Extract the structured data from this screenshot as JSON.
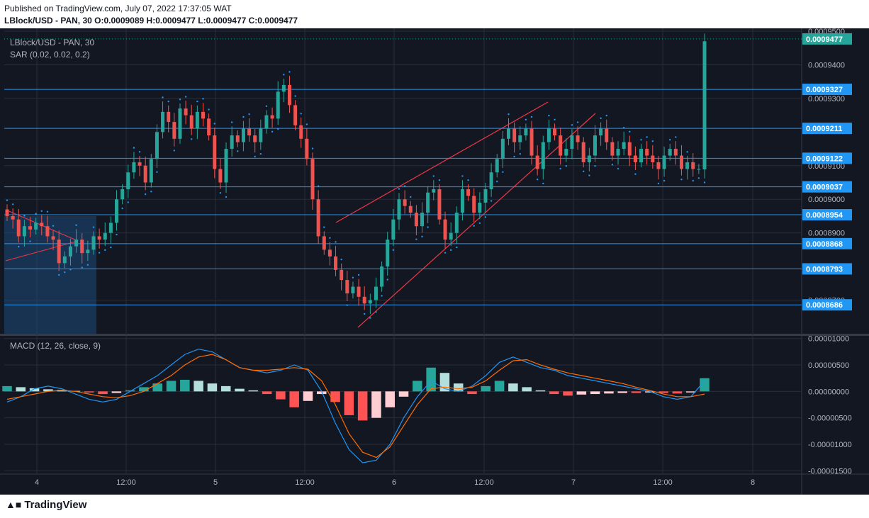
{
  "header": {
    "published": "Published on TradingView.com, July 07, 2022 17:37:05 WAT",
    "ohlc": "LBlock/USD - PAN, 30 O:0.0009089 H:0.0009477 L:0.0009477 C:0.0009477"
  },
  "legend": {
    "symbol": "LBlock/USD - PAN, 30",
    "sar": "SAR (0.02, 0.02, 0.2)",
    "macd": "MACD (12, 26, close, 9)"
  },
  "footer": {
    "logo_text": "TradingView"
  },
  "colors": {
    "background": "#131722",
    "grid": "#2a2e39",
    "up": "#26a69a",
    "down": "#ef5350",
    "level_line": "#2962ff",
    "label_bg": "#2196f3",
    "last_price_bg": "#26a69a",
    "sar_dots": "#2196f3",
    "macd_line": "#2196f3",
    "signal_line": "#ff6d00",
    "hist_up_strong": "#26a69a",
    "hist_up_weak": "#b2dfdb",
    "hist_down_strong": "#ff5252",
    "hist_down_weak": "#ffcdd2",
    "trend_line": "#f23645"
  },
  "chart_data": [
    {
      "type": "candlestick",
      "symbol": "LBlock/USD - PAN, 30",
      "x_ticks": [
        "4",
        "12:00",
        "5",
        "12:00",
        "6",
        "12:00",
        "7",
        "12:00",
        "8"
      ],
      "price_ticks": [
        "0.0009500",
        "0.0009400",
        "0.0009300",
        "0.0009100",
        "0.0009000",
        "0.0008900",
        "0.0008700"
      ],
      "ylim": [
        0.00086,
        0.00095
      ],
      "horizontal_levels": [
        "0.0009327",
        "0.0009211",
        "0.0009122",
        "0.0009037",
        "0.0008954",
        "0.0008868",
        "0.0008793",
        "0.0008686"
      ],
      "last_price": "0.0009477",
      "ohlc_last": {
        "open": 0.0009089,
        "high": 0.0009477,
        "low": 0.0009477,
        "close": 0.0009477
      },
      "indicator": "SAR (0.02, 0.02, 0.2)",
      "closes": [
        0.000895,
        0.000894,
        0.000889,
        0.000892,
        0.000891,
        0.000893,
        0.000892,
        0.000889,
        0.000888,
        0.000881,
        0.000883,
        0.000886,
        0.000888,
        0.000884,
        0.000885,
        0.000889,
        0.000888,
        0.00089,
        0.000893,
        0.0009,
        0.000903,
        0.000908,
        0.000911,
        0.00091,
        0.000905,
        0.000912,
        0.00092,
        0.000926,
        0.000923,
        0.000918,
        0.000927,
        0.000925,
        0.000921,
        0.000926,
        0.000924,
        0.000919,
        0.000909,
        0.000905,
        0.000915,
        0.000919,
        0.000917,
        0.000921,
        0.000919,
        0.000917,
        0.000921,
        0.000925,
        0.000924,
        0.000932,
        0.000934,
        0.000928,
        0.000922,
        0.000918,
        0.000912,
        0.0009,
        0.000889,
        0.000885,
        0.000883,
        0.000879,
        0.000876,
        0.000872,
        0.000874,
        0.000871,
        0.000869,
        0.00087,
        0.000874,
        0.00088,
        0.000888,
        0.000894,
        0.0009,
        0.000898,
        0.000896,
        0.000892,
        0.000896,
        0.000902,
        0.000903,
        0.000894,
        0.000888,
        0.00089,
        0.000896,
        0.000903,
        0.000901,
        0.000896,
        0.000899,
        0.000903,
        0.000908,
        0.000912,
        0.000918,
        0.000921,
        0.000917,
        0.000919,
        0.000921,
        0.000913,
        0.000909,
        0.000917,
        0.000921,
        0.000919,
        0.000913,
        0.000915,
        0.000919,
        0.000917,
        0.000911,
        0.000913,
        0.000919,
        0.000921,
        0.000917,
        0.000913,
        0.000915,
        0.000917,
        0.000913,
        0.000911,
        0.000915,
        0.000913,
        0.000911,
        0.000909,
        0.000913,
        0.000915,
        0.000913,
        0.000909,
        0.000911,
        0.000909,
        0.000909,
        0.000947
      ]
    },
    {
      "type": "macd",
      "title": "MACD (12, 26, close, 9)",
      "y_ticks": [
        "0.00001000",
        "0.00000500",
        "0.00000000",
        "-0.00000500",
        "-0.00001000",
        "-0.00001500"
      ],
      "ylim": [
        -1.55e-05,
        1.05e-05
      ],
      "macd_line": [
        -2e-06,
        -1e-06,
        5e-07,
        1e-06,
        5e-07,
        -5e-07,
        -1.5e-06,
        -2e-06,
        -1.5e-06,
        0.0,
        1.5e-06,
        3e-06,
        5e-06,
        7e-06,
        8e-06,
        7.5e-06,
        6e-06,
        4.5e-06,
        4e-06,
        3.5e-06,
        4e-06,
        5e-06,
        4e-06,
        0.0,
        -6e-06,
        -1.1e-05,
        -1.35e-05,
        -1.3e-05,
        -1e-05,
        -5e-06,
        -1e-06,
        2e-06,
        5e-07,
        0.0,
        1e-06,
        3e-06,
        5.5e-06,
        6.5e-06,
        5.5e-06,
        4.5e-06,
        4e-06,
        3e-06,
        2.5e-06,
        2e-06,
        1.5e-06,
        1e-06,
        5e-07,
        0.0,
        -1e-06,
        -1.5e-06,
        -1e-06,
        2e-06
      ],
      "signal_line": [
        -1.5e-06,
        -1e-06,
        -5e-07,
        0.0,
        2e-07,
        0.0,
        -5e-07,
        -1e-06,
        -1.2e-06,
        -8e-07,
        0.0,
        1.5e-06,
        3e-06,
        5e-06,
        6.5e-06,
        7e-06,
        6e-06,
        4.5e-06,
        4e-06,
        4e-06,
        4.2e-06,
        4.5e-06,
        4.2e-06,
        2e-06,
        -2.5e-06,
        -8e-06,
        -1.15e-05,
        -1.25e-05,
        -1.05e-05,
        -6.5e-06,
        -2.5e-06,
        5e-07,
        8e-07,
        5e-07,
        8e-07,
        2e-06,
        4e-06,
        5.8e-06,
        6e-06,
        5e-06,
        4.2e-06,
        3.5e-06,
        3e-06,
        2.5e-06,
        2e-06,
        1.5e-06,
        8e-07,
        2e-07,
        -5e-07,
        -1e-06,
        -1e-06,
        -5e-07
      ],
      "histogram": [
        1e-06,
        8e-07,
        6e-07,
        4e-07,
        3e-07,
        1e-07,
        -2e-07,
        -5e-07,
        -3e-07,
        2e-07,
        8e-07,
        1.5e-06,
        2e-06,
        2.2e-06,
        2e-06,
        1.5e-06,
        1e-06,
        5e-07,
        2e-07,
        -5e-07,
        -1.5e-06,
        -3e-06,
        -1.8e-06,
        -5e-07,
        -2e-06,
        -4.5e-06,
        -5.5e-06,
        -5e-06,
        -3e-06,
        -1e-06,
        2e-06,
        4.5e-06,
        3.5e-06,
        1.5e-06,
        -5e-07,
        1e-06,
        2e-06,
        1.5e-06,
        8e-07,
        2e-07,
        -5e-07,
        -8e-07,
        -6e-07,
        -5e-07,
        -4e-07,
        -3e-07,
        -3e-07,
        -2e-07,
        -3e-07,
        -4e-07,
        -2e-07,
        2.5e-06
      ]
    }
  ]
}
